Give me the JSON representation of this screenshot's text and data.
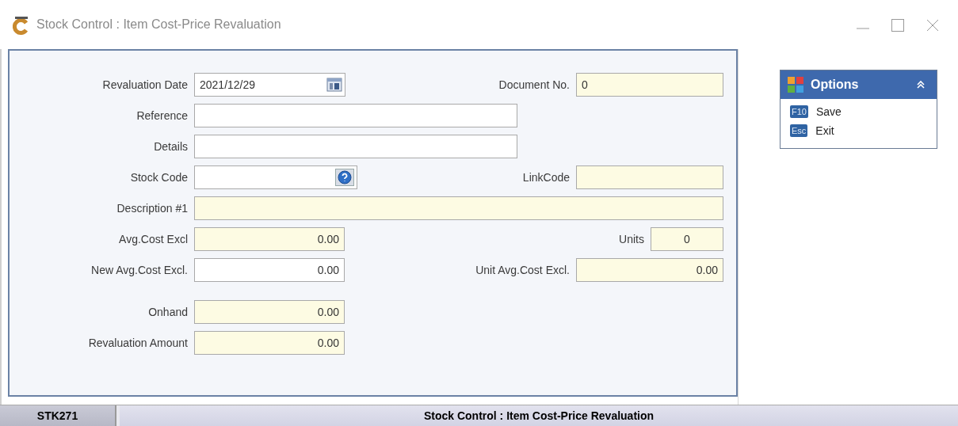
{
  "window": {
    "title": "Stock Control : Item Cost-Price Revaluation"
  },
  "form": {
    "sections": [
      [
        {
          "left": {
            "label": "Revaluation Date",
            "value": "2021/12/29",
            "kind": "date",
            "readonly": false
          },
          "right": {
            "label": "Document No.",
            "value": "0",
            "kind": "text",
            "readonly": true
          }
        },
        {
          "left": {
            "label": "Reference",
            "kind": "text",
            "readonly": false
          }
        },
        {
          "left": {
            "label": "Details",
            "kind": "text",
            "readonly": false
          }
        },
        {
          "left": {
            "label": "Stock Code",
            "kind": "lookup",
            "readonly": false
          },
          "right": {
            "label": "LinkCode",
            "kind": "text",
            "readonly": true
          }
        },
        {
          "left": {
            "label": "Description #1",
            "kind": "wide",
            "readonly": true
          }
        },
        {
          "left": {
            "label": "Avg.Cost Excl",
            "value": "0.00",
            "kind": "amount",
            "readonly": true
          },
          "right": {
            "label": "Units",
            "value": "0",
            "kind": "count",
            "readonly": true
          }
        },
        {
          "left": {
            "label": "New Avg.Cost Excl.",
            "value": "0.00",
            "kind": "amount",
            "readonly": false
          },
          "right": {
            "label": "Unit Avg.Cost Excl.",
            "value": "0.00",
            "kind": "amount",
            "readonly": true
          }
        }
      ],
      [
        {
          "left": {
            "label": "Onhand",
            "value": "0.00",
            "kind": "amount",
            "readonly": true
          }
        },
        {
          "left": {
            "label": "Revaluation Amount",
            "value": "0.00",
            "kind": "amount",
            "readonly": true
          }
        }
      ]
    ]
  },
  "options": {
    "title": "Options",
    "expanded": true,
    "items": [
      {
        "key": "F10",
        "label": "Save"
      },
      {
        "key": "Esc",
        "label": "Exit"
      }
    ]
  },
  "status_bar": {
    "code": "STK271",
    "title": "Stock Control : Item Cost-Price Revaluation"
  }
}
